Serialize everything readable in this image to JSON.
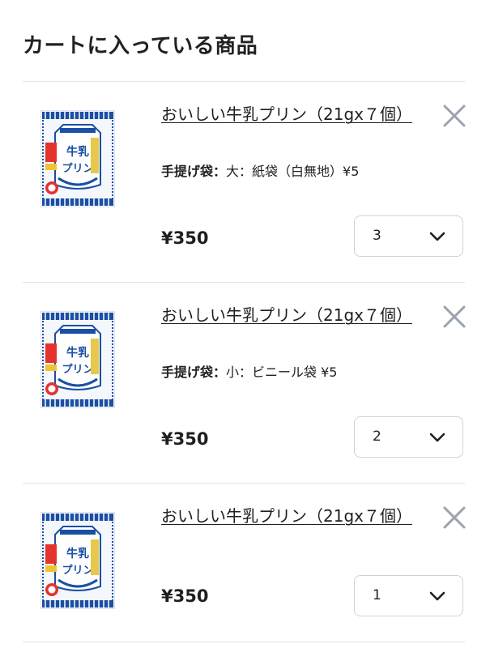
{
  "page": {
    "title": "カートに入っている商品"
  },
  "cart": {
    "items": [
      {
        "name": "おいしい牛乳プリン（21gx７個）",
        "option_label": "手提げ袋：",
        "option_value": "大：紙袋（白無地）¥5",
        "price": "¥350",
        "quantity": "3"
      },
      {
        "name": "おいしい牛乳プリン（21gx７個）",
        "option_label": "手提げ袋：",
        "option_value": "小：ビニール袋 ¥5",
        "price": "¥350",
        "quantity": "2"
      },
      {
        "name": "おいしい牛乳プリン（21gx７個）",
        "price": "¥350",
        "quantity": "1"
      }
    ]
  },
  "icons": {
    "remove": "close-icon",
    "quantity_dropdown": "chevron-down-icon",
    "product_image": "pudding-package-image"
  },
  "colors": {
    "text": "#1f1f1f",
    "remove_icon": "#9aa3ae",
    "border": "#cfd3d8",
    "divider": "#e3e3e3",
    "package_blue": "#1a4fa3"
  }
}
